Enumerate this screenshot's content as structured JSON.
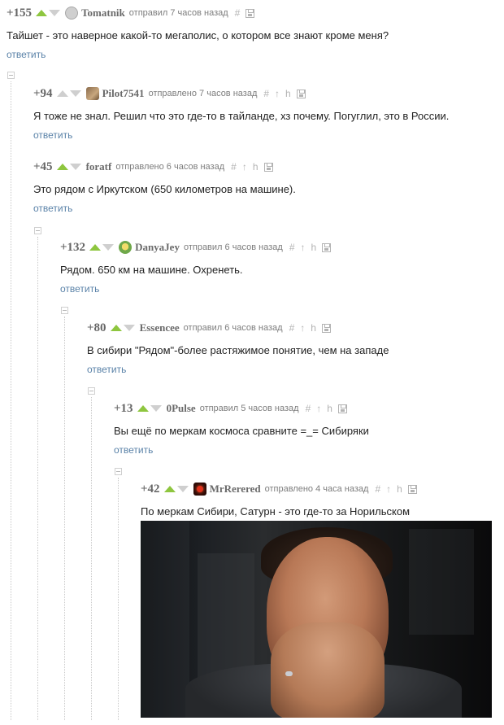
{
  "comments": [
    {
      "rating": "+155",
      "author": "Tomatnik",
      "meta": "отправил 7 часов назад",
      "text": "Тайшет - это наверное какой-то мегаполис, о котором все знают кроме меня?",
      "reply": "ответить",
      "tools": {
        "link": "#",
        "save": "save-icon"
      }
    },
    {
      "rating": "+94",
      "author": "Pilot7541",
      "meta": "отправлено 7 часов назад",
      "text": "Я тоже не знал. Решил что это где-то в тайланде, хз почему. Погуглил, это в России.",
      "reply": "ответить",
      "tools": {
        "link": "#",
        "parent": "↑",
        "branch": "h",
        "save": "save-icon"
      }
    },
    {
      "rating": "+45",
      "author": "foratf",
      "meta": "отправлено 6 часов назад",
      "text": "Это рядом с Иркутском (650 километров на машине).",
      "reply": "ответить",
      "tools": {
        "link": "#",
        "parent": "↑",
        "branch": "h",
        "save": "save-icon"
      }
    },
    {
      "rating": "+132",
      "author": "DanyaJey",
      "meta": "отправил 6 часов назад",
      "text": "Рядом. 650 км на машине. Охренеть.",
      "reply": "ответить",
      "tools": {
        "link": "#",
        "parent": "↑",
        "branch": "h",
        "save": "save-icon"
      }
    },
    {
      "rating": "+80",
      "author": "Essencee",
      "meta": "отправил 6 часов назад",
      "text": "В сибири \"Рядом\"-более растяжимое понятие, чем на западе",
      "reply": "ответить",
      "tools": {
        "link": "#",
        "parent": "↑",
        "branch": "h",
        "save": "save-icon"
      }
    },
    {
      "rating": "+13",
      "author": "0Pulse",
      "meta": "отправил 5 часов назад",
      "text": "Вы ещё по меркам космоса сравните =_= Сибиряки",
      "reply": "ответить",
      "tools": {
        "link": "#",
        "parent": "↑",
        "branch": "h",
        "save": "save-icon"
      }
    },
    {
      "rating": "+42",
      "author": "MrRerered",
      "meta": "отправлено 4 часа назад",
      "text": "По меркам Сибири, Сатурн - это где-то за Норильском",
      "tools": {
        "link": "#",
        "parent": "↑",
        "branch": "h",
        "save": "save-icon"
      }
    }
  ],
  "colors": {
    "vote_up": "#8ec63f",
    "vote_down": "#cfcfcf",
    "reply_link": "#5a82a8"
  }
}
